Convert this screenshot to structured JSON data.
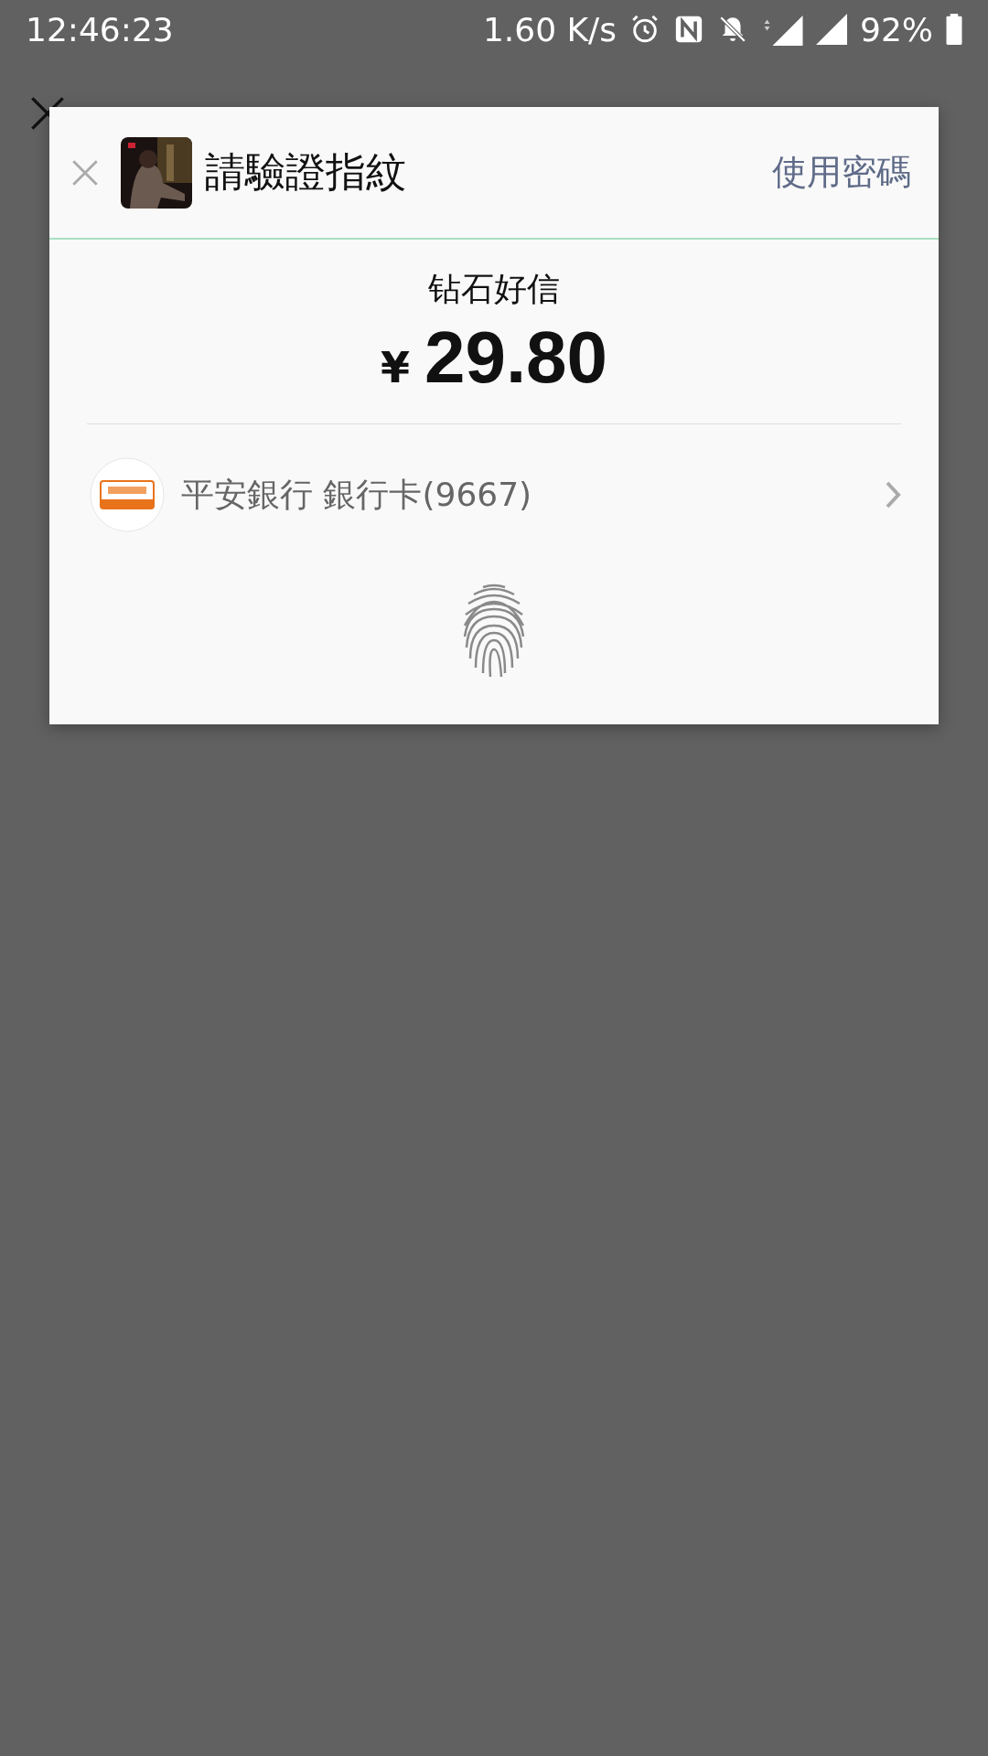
{
  "status_bar": {
    "time": "12:46:23",
    "speed": "1.60 K/s",
    "battery": "92%"
  },
  "dialog": {
    "title": "請驗證指紋",
    "alt_action": "使用密碼",
    "merchant": "钻石好信",
    "currency": "¥",
    "amount": "29.80",
    "payment_method": "平安銀行 銀行卡(9667)"
  }
}
